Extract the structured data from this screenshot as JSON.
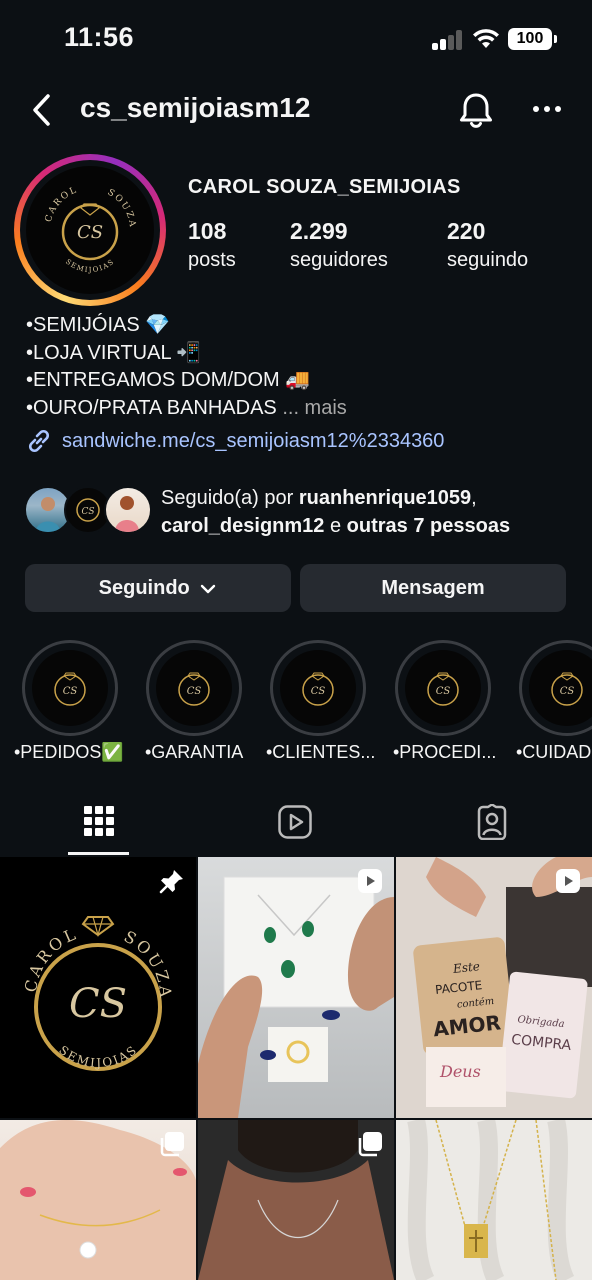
{
  "status_bar": {
    "time": "11:56",
    "battery": "100"
  },
  "header": {
    "username": "cs_semijoiasm12"
  },
  "profile": {
    "display_name": "CAROL SOUZA_SEMIJOIAS",
    "stats": [
      {
        "value": "108",
        "label": "posts"
      },
      {
        "value": "2.299",
        "label": "seguidores"
      },
      {
        "value": "220",
        "label": "seguindo"
      }
    ],
    "bio": [
      "•SEMIJÓIAS 💎",
      "•LOJA VIRTUAL 📲",
      "•ENTREGAMOS DOM/DOM 🚚",
      "•OURO/PRATA BANHADAS"
    ],
    "bio_more": "... mais",
    "link": "sandwiche.me/cs_semijoiasm12%2334360",
    "logo_text": {
      "top_left": "CAROL",
      "top_right": "SOUZA",
      "bottom": "SEMIJOIAS",
      "monogram": "CS"
    }
  },
  "followed_by": {
    "prefix": "Seguido(a) por ",
    "user1": "ruanhenrique1059",
    "comma": ",",
    "user2": "carol_designm12",
    "middle": " e ",
    "others": "outras 7 pessoas"
  },
  "buttons": {
    "following": "Seguindo",
    "message": "Mensagem"
  },
  "highlights": [
    {
      "label": "•PEDIDOS✅"
    },
    {
      "label": "•GARANTIA"
    },
    {
      "label": "•CLIENTES..."
    },
    {
      "label": "•PROCEDI..."
    },
    {
      "label": "•CUIDAD"
    }
  ],
  "post_text": {
    "tag_line1": "Este",
    "tag_line2": "PACOTE",
    "tag_line3": "contém",
    "tag_line4": "AMOR",
    "tag2_line1": "Obrigada",
    "tag2_line2": "COMPRA",
    "tag3": "Deus"
  },
  "colors": {
    "background": "#0c1014",
    "button": "#262a30",
    "link": "#a9c4ff",
    "gold": "#c9a24a"
  }
}
